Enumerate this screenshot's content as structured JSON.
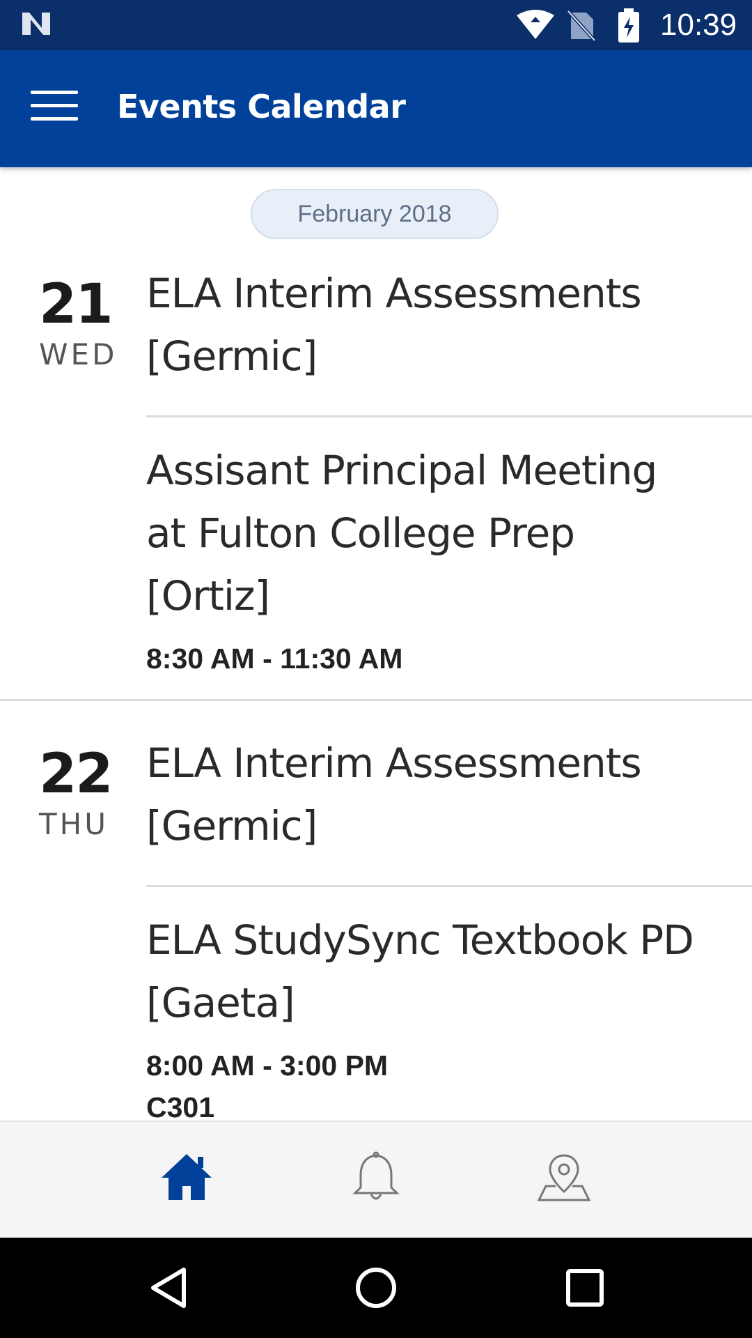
{
  "status_bar": {
    "time": "10:39"
  },
  "app_bar": {
    "title": "Events Calendar"
  },
  "month_label": "February 2018",
  "days": [
    {
      "day_num": "21",
      "day_name": "WED",
      "events": [
        {
          "title": "ELA Interim Assessments [Germic]",
          "time": "",
          "location": ""
        },
        {
          "title": "Assisant Principal Meeting at Fulton College Prep [Ortiz]",
          "time": "8:30 AM - 11:30 AM",
          "location": ""
        }
      ]
    },
    {
      "day_num": "22",
      "day_name": "THU",
      "events": [
        {
          "title": "ELA Interim Assessments [Germic]",
          "time": "",
          "location": ""
        },
        {
          "title": "ELA StudySync Textbook PD [Gaeta]",
          "time": "8:00 AM - 3:00 PM",
          "location": "C301"
        }
      ]
    }
  ],
  "bottom_nav": {
    "active_color": "#02419a",
    "inactive_color": "#777777",
    "tabs": [
      "home-icon",
      "bell-icon",
      "map-pin-icon"
    ]
  },
  "colors": {
    "status_bar": "#0b2f6b",
    "app_bar": "#02419a"
  }
}
